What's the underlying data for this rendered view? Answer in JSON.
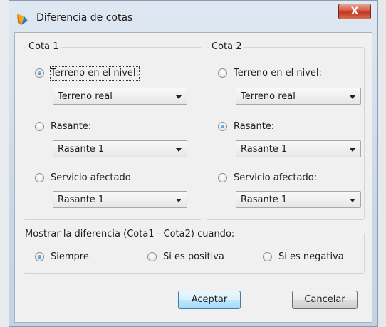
{
  "window": {
    "title": "Diferencia de cotas",
    "close_label": "X"
  },
  "cota1": {
    "title": "Cota 1",
    "terreno": {
      "label": "Terreno en el nivel:",
      "selected": true,
      "dropdown": "Terreno real"
    },
    "rasante": {
      "label": "Rasante:",
      "selected": false,
      "dropdown": "Rasante 1"
    },
    "servicio": {
      "label": "Servicio afectado",
      "selected": false,
      "dropdown": "Rasante 1"
    }
  },
  "cota2": {
    "title": "Cota 2",
    "terreno": {
      "label": "Terreno en el nivel:",
      "selected": false,
      "dropdown": "Terreno real"
    },
    "rasante": {
      "label": "Rasante:",
      "selected": true,
      "dropdown": "Rasante 1"
    },
    "servicio": {
      "label": "Servicio afectado:",
      "selected": false,
      "dropdown": "Rasante 1"
    }
  },
  "mostrar": {
    "title": "Mostrar la diferencia (Cota1 - Cota2) cuando:",
    "siempre": {
      "label": "Siempre",
      "selected": true
    },
    "positiva": {
      "label": "Si es positiva",
      "selected": false
    },
    "negativa": {
      "label": "Si es negativa",
      "selected": false
    }
  },
  "buttons": {
    "accept": "Aceptar",
    "cancel": "Cancelar"
  },
  "colors": {
    "title_bar": "#c9d8e8",
    "close_button": "#c2371e",
    "default_button": "#bee6fd"
  }
}
